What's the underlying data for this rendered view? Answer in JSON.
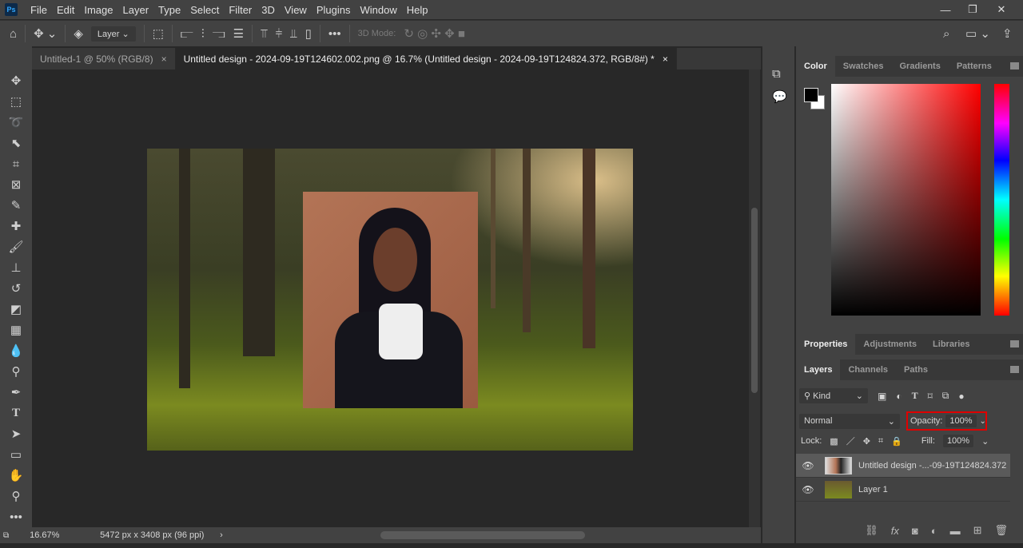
{
  "app": {
    "logo": "Ps"
  },
  "menu": [
    "File",
    "Edit",
    "Image",
    "Layer",
    "Type",
    "Select",
    "Filter",
    "3D",
    "View",
    "Plugins",
    "Window",
    "Help"
  ],
  "options": {
    "auto_select_value": "Layer",
    "mode_label": "3D Mode:"
  },
  "tabs": [
    {
      "label": "Untitled-1 @ 50% (RGB/8)",
      "close": "×"
    },
    {
      "label": "Untitled design - 2024-09-19T124602.002.png @ 16.7% (Untitled design - 2024-09-19T124824.372, RGB/8#) *",
      "close": "×"
    }
  ],
  "status": {
    "zoom": "16.67%",
    "doc_info": "5472 px x 3408 px (96 ppi)",
    "arrow": "›"
  },
  "color_panel": {
    "tabs": [
      "Color",
      "Swatches",
      "Gradients",
      "Patterns"
    ],
    "foreground": "#000000",
    "background": "#ffffff"
  },
  "properties_panel": {
    "tabs": [
      "Properties",
      "Adjustments",
      "Libraries"
    ]
  },
  "layers_panel": {
    "tabs": [
      "Layers",
      "Channels",
      "Paths"
    ],
    "filter": "Kind",
    "blend_mode": "Normal",
    "opacity_label": "Opacity:",
    "opacity": "100%",
    "lock_label": "Lock:",
    "fill_label": "Fill:",
    "fill": "100%",
    "layers": [
      {
        "name": "Untitled design -...-09-19T124824.372",
        "selected": true
      },
      {
        "name": "Layer 1",
        "selected": false
      }
    ]
  },
  "highlight_color": "#e00000"
}
